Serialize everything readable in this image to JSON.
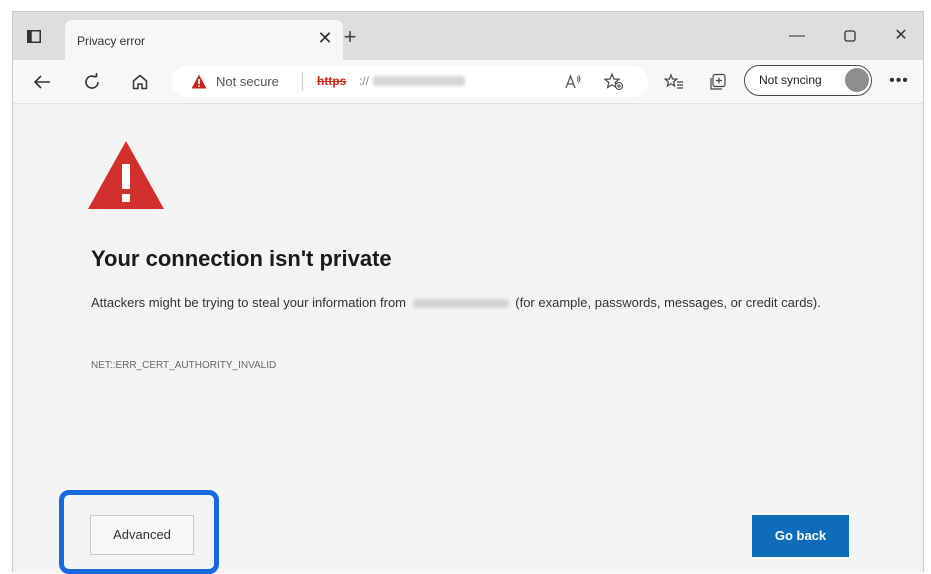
{
  "tab": {
    "title": "Privacy error"
  },
  "address_bar": {
    "security_label": "Not secure",
    "url_scheme": "https",
    "url_separator": "://"
  },
  "profile": {
    "sync_label": "Not syncing"
  },
  "page": {
    "heading": "Your connection isn't private",
    "body_before": "Attackers might be trying to steal your information from",
    "body_after": "(for example, passwords, messages, or credit cards).",
    "error_code": "NET::ERR_CERT_AUTHORITY_INVALID",
    "advanced_label": "Advanced",
    "go_back_label": "Go back"
  },
  "colors": {
    "warning_red": "#d32f2f",
    "primary_blue": "#0f6cbd",
    "highlight_blue": "#1769e0"
  },
  "icons": [
    "tab-actions-icon",
    "close-icon",
    "plus-icon",
    "minimize-icon",
    "maximize-icon",
    "back-arrow-icon",
    "refresh-icon",
    "home-icon",
    "warning-icon",
    "read-aloud-icon",
    "favorite-add-icon",
    "favorites-icon",
    "collections-icon",
    "more-icon"
  ]
}
